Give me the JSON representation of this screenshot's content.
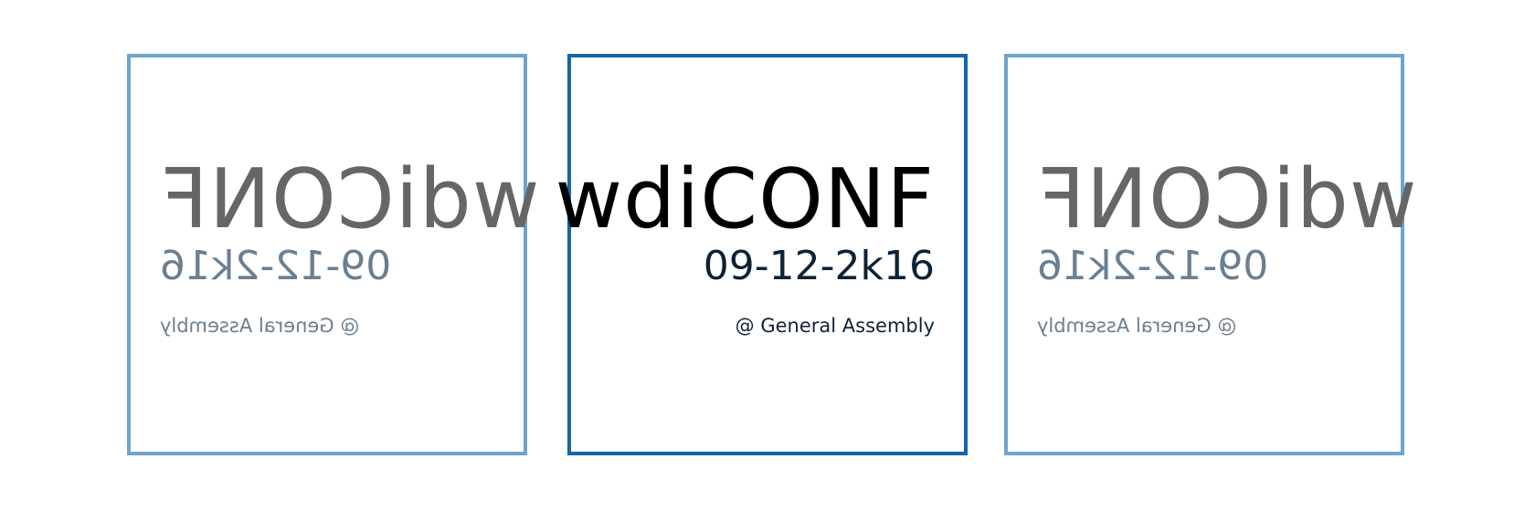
{
  "cards": [
    {
      "title": "wdiCONF",
      "date": "09-12-2k16",
      "venue": "@ General Assembly",
      "mirrored": true
    },
    {
      "title": "wdiCONF",
      "date": "09-12-2k16",
      "venue": "@ General Assembly",
      "mirrored": false
    },
    {
      "title": "wdiCONF",
      "date": "09-12-2k16",
      "venue": "@ General Assembly",
      "mirrored": true
    }
  ],
  "colors": {
    "side_border": "#6fa4cc",
    "center_border": "#1565a8",
    "center_title": "#000000",
    "side_title": "#666666"
  }
}
